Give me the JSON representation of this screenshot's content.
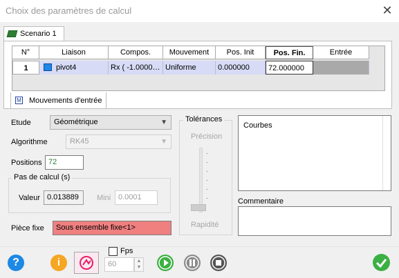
{
  "window": {
    "title": "Choix des paramètres de calcul",
    "close_glyph": "✕"
  },
  "tab": {
    "label": "Scenario 1",
    "icon": "scenario-icon"
  },
  "table": {
    "headers": [
      "N°",
      "Liaison",
      "Compos.",
      "Mouvement",
      "Pos. Init",
      "Pos. Fin.",
      "Entrée"
    ],
    "rows": [
      {
        "n": "1",
        "liaison": "pivot4",
        "compos": "Rx ( -1.0000…",
        "mouvement": "Uniforme",
        "pos_init": "0.000000",
        "pos_fin": "72.000000",
        "entree": ""
      }
    ]
  },
  "mouvements_tab": {
    "label": "Mouvements d'entrée",
    "icon": "mouvements-icon"
  },
  "etude": {
    "label": "Etude",
    "value": "Géométrique"
  },
  "algorithme": {
    "label": "Algorithme",
    "value": "RK45"
  },
  "positions": {
    "label": "Positions",
    "value": "72"
  },
  "pas_de_calcul": {
    "label": "Pas de calcul (s)",
    "valeur_label": "Valeur",
    "valeur": "0.013889",
    "mini_label": "Mini",
    "mini": "0.0001"
  },
  "tolerances": {
    "label": "Tolérances",
    "precision": "Précision",
    "rapidite": "Rapidité"
  },
  "courbes": {
    "label": "Courbes"
  },
  "commentaire": {
    "label": "Commentaire"
  },
  "piece_fixe": {
    "label": "Pièce fixe",
    "value": "Sous ensemble fixe<1>"
  },
  "toolbar": {
    "fps_label": "Fps",
    "fps_value": "60",
    "icons": [
      "help-icon",
      "info-icon",
      "animate-icon",
      "play-icon",
      "pause-icon",
      "stop-icon",
      "validate-icon"
    ]
  },
  "colors": {
    "selected_row": "#d7dbf5",
    "piece_fixe_bg": "#f08080",
    "play": "#3cb043",
    "info": "#f5a623",
    "help": "#1e88e5"
  }
}
